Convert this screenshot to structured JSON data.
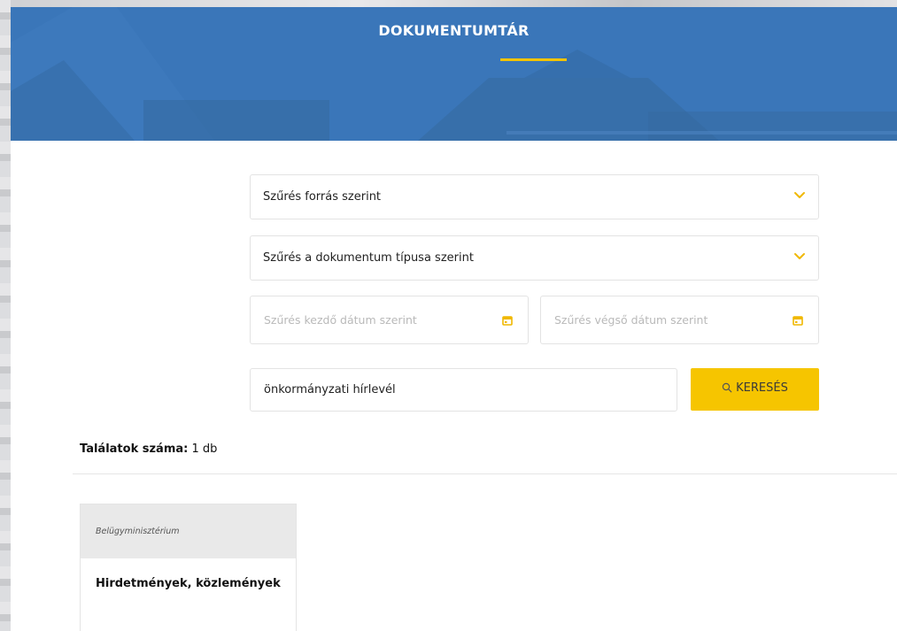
{
  "header": {
    "title": "DOKUMENTUMTÁR"
  },
  "filters": {
    "source_select_label": "Szűrés forrás szerint",
    "type_select_label": "Szűrés a dokumentum típusa szerint",
    "start_date_placeholder": "Szűrés kezdő dátum szerint",
    "end_date_placeholder": "Szűrés végső dátum szerint"
  },
  "search": {
    "value": "önkormányzati hírlevél",
    "button_label": "KERESÉS"
  },
  "results": {
    "count_label": "Találatok száma:",
    "count_value": "1 db",
    "items": [
      {
        "source": "Belügyminisztérium",
        "title": "Hirdetmények, közlemények"
      }
    ]
  },
  "colors": {
    "hero_blue": "#3a76b9",
    "accent_yellow": "#f6c500"
  },
  "icons": {
    "select_chevron": "chevron-down-icon",
    "date_picker": "calendar-icon",
    "search": "search-icon"
  }
}
